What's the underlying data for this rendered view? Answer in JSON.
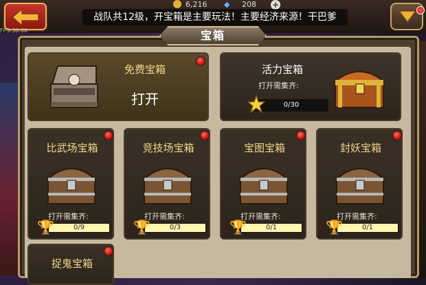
{
  "header": {
    "back_icon": "left-arrow-icon",
    "menu_icon": "down-triangle-icon",
    "broadcast": "战队共12级，开宝箱是主要玩法！主要经济来源！干巴爹",
    "resources": [
      {
        "icon": "gold-coin-icon",
        "value": "6,216"
      },
      {
        "icon": "diamond-icon",
        "value": "208"
      }
    ],
    "fps": "FPS:30.00"
  },
  "panel": {
    "title": "宝箱"
  },
  "free_chest": {
    "title": "免费宝箱",
    "action": "打开",
    "icon": "open-skull-chest-icon"
  },
  "energy_chest": {
    "title": "活力宝箱",
    "requirement": "打开需集齐:",
    "progress": "0/30",
    "progress_fraction": 0,
    "icon": "golden-chest-icon",
    "progress_icon": "star-icon"
  },
  "chests": [
    {
      "title": "比武场宝箱",
      "requirement": "打开需集齐:",
      "progress": "0/9",
      "icon": "wooden-chest-icon",
      "progress_icon": "trophy-icon"
    },
    {
      "title": "竞技场宝箱",
      "requirement": "打开需集齐:",
      "progress": "0/3",
      "icon": "wooden-chest-icon",
      "progress_icon": "trophy-icon"
    },
    {
      "title": "宝图宝箱",
      "requirement": "打开需集齐:",
      "progress": "0/1",
      "icon": "wooden-chest-icon",
      "progress_icon": "trophy-icon"
    },
    {
      "title": "封妖宝箱",
      "requirement": "打开需集齐:",
      "progress": "0/1",
      "icon": "wooden-chest-icon",
      "progress_icon": "trophy-icon"
    }
  ],
  "ghost_chest": {
    "title": "捉鬼宝箱"
  },
  "colors": {
    "accent_gold": "#f0d88a",
    "notify_red": "#c81414",
    "progress_fill": "#fff6b0"
  }
}
